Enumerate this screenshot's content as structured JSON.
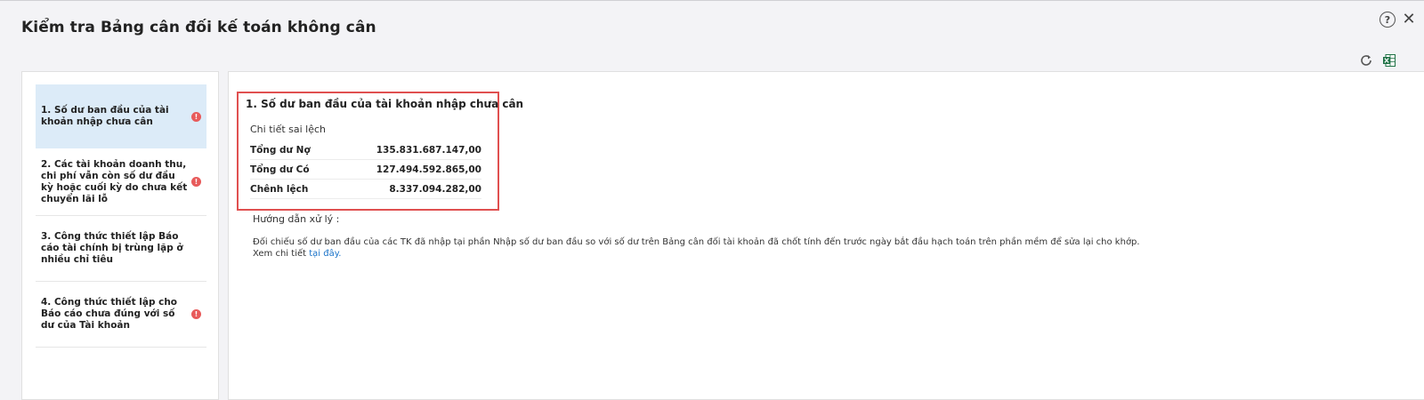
{
  "dialog": {
    "title": "Kiểm tra Bảng cân đối kế toán không cân",
    "help_symbol": "?",
    "close_symbol": "✕"
  },
  "nav": {
    "items": [
      {
        "label": "1. Số dư ban đầu của tài khoản nhập chưa cân",
        "warning": true,
        "active": true
      },
      {
        "label": "2. Các tài khoản doanh thu, chi phí vẫn còn số dư đầu kỳ hoặc cuối kỳ do chưa kết chuyển lãi lỗ",
        "warning": true,
        "active": false
      },
      {
        "label": "3. Công thức thiết lập Báo cáo tài chính bị trùng lặp ở nhiều chỉ tiêu",
        "warning": false,
        "active": false
      },
      {
        "label": "4. Công thức thiết lập cho Báo cáo chưa đúng với số dư của Tài khoản",
        "warning": true,
        "active": false
      }
    ],
    "warning_symbol": "!"
  },
  "detail": {
    "title": "1. Số dư ban đầu của tài khoản nhập chưa cân",
    "subtitle": "Chi tiết sai lệch",
    "rows": [
      {
        "label": "Tổng dư Nợ",
        "value": "135.831.687.147,00"
      },
      {
        "label": "Tổng dư Có",
        "value": "127.494.592.865,00"
      },
      {
        "label": "Chênh lệch",
        "value": "8.337.094.282,00"
      }
    ],
    "guide_title": "Hướng dẫn xử lý :",
    "guide_text": "Đối chiếu số dư ban đầu của các TK đã nhập tại phần Nhập số dư ban đầu so với số dư trên Bảng cân đối tài khoản đã chốt tính đến trước ngày bắt đầu hạch toán trên phần mềm để sửa lại cho khớp.",
    "guide_more_prefix": "Xem chi tiết ",
    "guide_link": "tại đây."
  },
  "colors": {
    "accent_link": "#1a73c9",
    "warning": "#e85b5b",
    "highlight_border": "#e05050",
    "active_item_bg": "#dcebf8",
    "excel_green": "#1e7145"
  }
}
